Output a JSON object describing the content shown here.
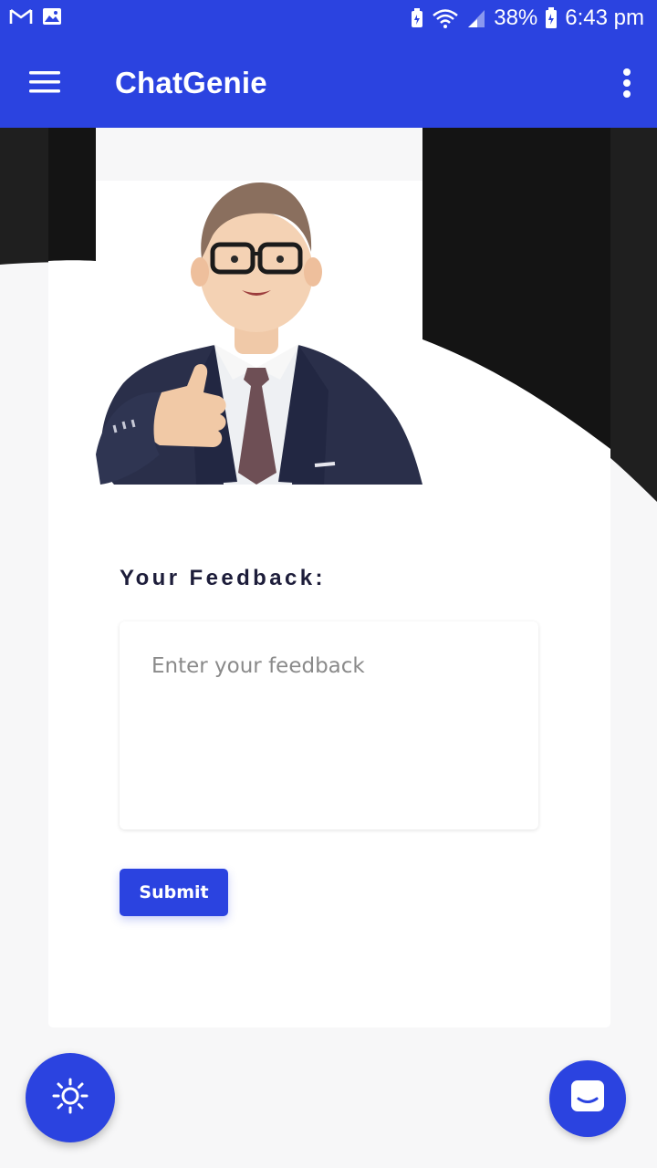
{
  "status_bar": {
    "notification_icons": [
      "gmail-icon",
      "gallery-icon"
    ],
    "system_icons": [
      "battery-saver-icon",
      "wifi-icon",
      "signal-icon",
      "battery-icon"
    ],
    "battery": "38%",
    "time": "6:43 pm"
  },
  "app_bar": {
    "title": "ChatGenie",
    "menu_icon": "hamburger-menu-icon",
    "more_icon": "more-vertical-icon"
  },
  "feedback": {
    "label": "Your Feedback:",
    "placeholder": "Enter your feedback",
    "value": "",
    "submit_label": "Submit"
  },
  "fabs": {
    "theme_icon": "sun-icon",
    "chat_icon": "chat-icon"
  },
  "colors": {
    "primary": "#2b43e0",
    "dark_bg": "#141414",
    "page_bg": "#f7f7f8"
  }
}
